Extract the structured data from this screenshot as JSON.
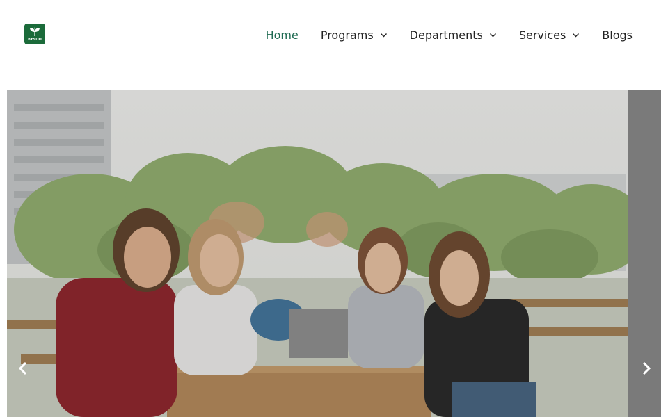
{
  "header": {
    "logo": {
      "icon": "leaf-logo-icon",
      "text": "BYSDO",
      "color": "#1b6b3a"
    },
    "nav": [
      {
        "label": "Home",
        "active": true,
        "dropdown": false
      },
      {
        "label": "Programs",
        "active": false,
        "dropdown": true
      },
      {
        "label": "Departments",
        "active": false,
        "dropdown": true
      },
      {
        "label": "Services",
        "active": false,
        "dropdown": true
      },
      {
        "label": "Blogs",
        "active": false,
        "dropdown": false
      }
    ],
    "active_color": "#1f6b52"
  },
  "hero": {
    "image": "photo of four students smiling at a picnic table on campus with a laptop",
    "prev_icon": "chevron-left-icon",
    "next_icon": "chevron-right-icon"
  }
}
